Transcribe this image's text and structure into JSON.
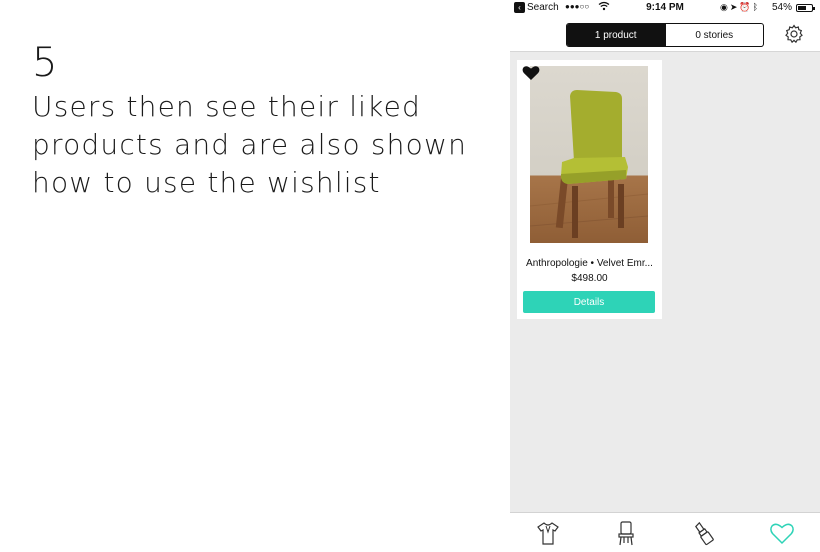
{
  "caption": {
    "step": "5",
    "line1": "Users then see their liked",
    "line2": "products and are also shown",
    "line3": "how to use the wishlist"
  },
  "status_bar": {
    "back_label": "Search",
    "signal": "●●●○○",
    "time": "9:14 PM",
    "battery_pct": "54%",
    "battery_level": 0.54
  },
  "segmented_control": {
    "products_label": "1 product",
    "stories_label": "0 stories",
    "selected": "products"
  },
  "product": {
    "name": "Anthropologie • Velvet Emr...",
    "price": "$498.00",
    "details_label": "Details",
    "liked": true
  },
  "tab_bar": {
    "items": [
      "clothing-icon",
      "chair-icon",
      "lipstick-icon",
      "heart-icon"
    ],
    "active": "heart-icon"
  },
  "colors": {
    "accent": "#2ed3b7",
    "screen_bg": "#ebebeb",
    "chair_fabric": "#a9b431"
  }
}
